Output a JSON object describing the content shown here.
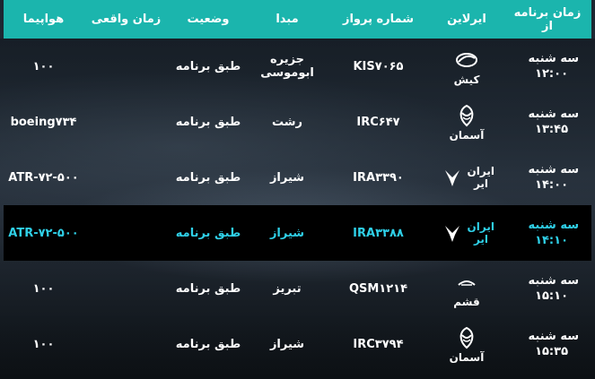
{
  "headers": {
    "scheduled": "زمان برنامه از",
    "airline": "ایرلاین",
    "flight": "شماره پرواز",
    "origin": "مبدا",
    "status": "وضعیت",
    "actual": "زمان واقعی",
    "aircraft": "هواپیما"
  },
  "rows": [
    {
      "day": "سه شنبه",
      "time": "۱۲:۰۰",
      "airline": "کیش",
      "logo": "kish-air-icon",
      "flight": "KIS۷۰۶۵",
      "origin": "جزیره ابوموسی",
      "status": "طبق برنامه",
      "actual": "",
      "aircraft": "۱۰۰"
    },
    {
      "day": "سه شنبه",
      "time": "۱۳:۴۵",
      "airline": "آسمان",
      "logo": "aseman-icon",
      "flight": "IRC۶۴۷",
      "origin": "رشت",
      "status": "طبق برنامه",
      "actual": "",
      "aircraft": "boeing۷۳۴"
    },
    {
      "day": "سه شنبه",
      "time": "۱۴:۰۰",
      "airline": "ایران ایر",
      "logo": "iran-air-icon",
      "flight": "IRA۳۳۹۰",
      "origin": "شیراز",
      "status": "طبق برنامه",
      "actual": "",
      "aircraft": "ATR-۷۲-۵۰۰"
    },
    {
      "day": "سه شنبه",
      "time": "۱۴:۱۰",
      "airline": "ایران ایر",
      "logo": "iran-air-icon",
      "flight": "IRA۳۳۸۸",
      "origin": "شیراز",
      "status": "طبق برنامه",
      "actual": "",
      "aircraft": "ATR-۷۲-۵۰۰"
    },
    {
      "day": "سه شنبه",
      "time": "۱۵:۱۰",
      "airline": "قشم",
      "logo": "qeshm-air-icon",
      "flight": "QSM۱۲۱۴",
      "origin": "تبریز",
      "status": "طبق برنامه",
      "actual": "",
      "aircraft": "۱۰۰"
    },
    {
      "day": "سه شنبه",
      "time": "۱۵:۳۵",
      "airline": "آسمان",
      "logo": "aseman-icon",
      "flight": "IRC۳۷۹۴",
      "origin": "شیراز",
      "status": "طبق برنامه",
      "actual": "",
      "aircraft": "۱۰۰"
    }
  ],
  "colors": {
    "header": "#1bb5ad",
    "highlight_text": "#2fd0e8",
    "highlight_row": "#000000"
  }
}
